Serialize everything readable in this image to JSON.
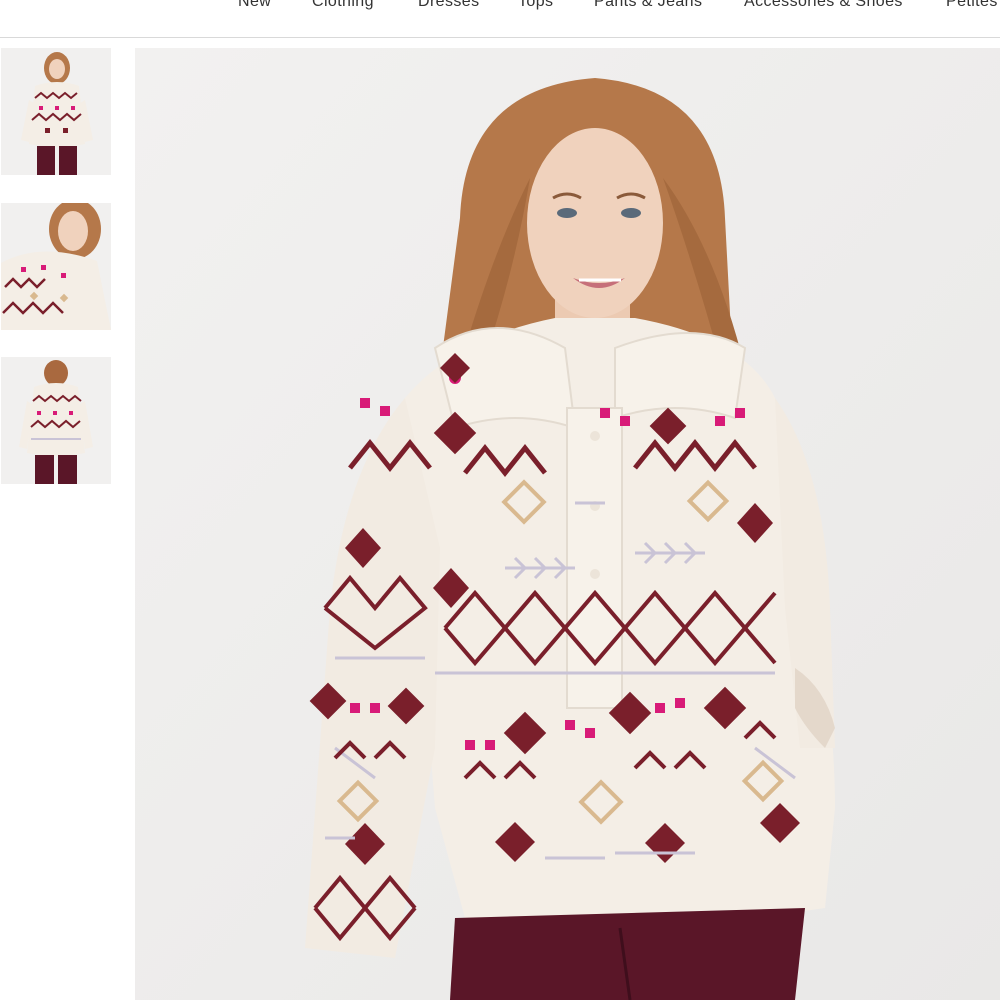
{
  "nav": {
    "items": [
      {
        "label": "New"
      },
      {
        "label": "Clothing"
      },
      {
        "label": "Dresses"
      },
      {
        "label": "Tops"
      },
      {
        "label": "Pants & Jeans"
      },
      {
        "label": "Accessories & Shoes"
      },
      {
        "label": "Petites"
      }
    ]
  },
  "gallery": {
    "thumbnails": [
      {
        "view": "front-full"
      },
      {
        "view": "close-up"
      },
      {
        "view": "back-full"
      }
    ],
    "main_view": "front-model"
  },
  "colors": {
    "sweater_base": "#f4eee6",
    "pattern_maroon": "#7a1f2b",
    "pattern_pink": "#d81b78",
    "pattern_tan": "#d9b98f",
    "pattern_lavender": "#c9c3d6",
    "leggings": "#5a1628",
    "hair": "#b5784a",
    "background": "#efeeed"
  }
}
